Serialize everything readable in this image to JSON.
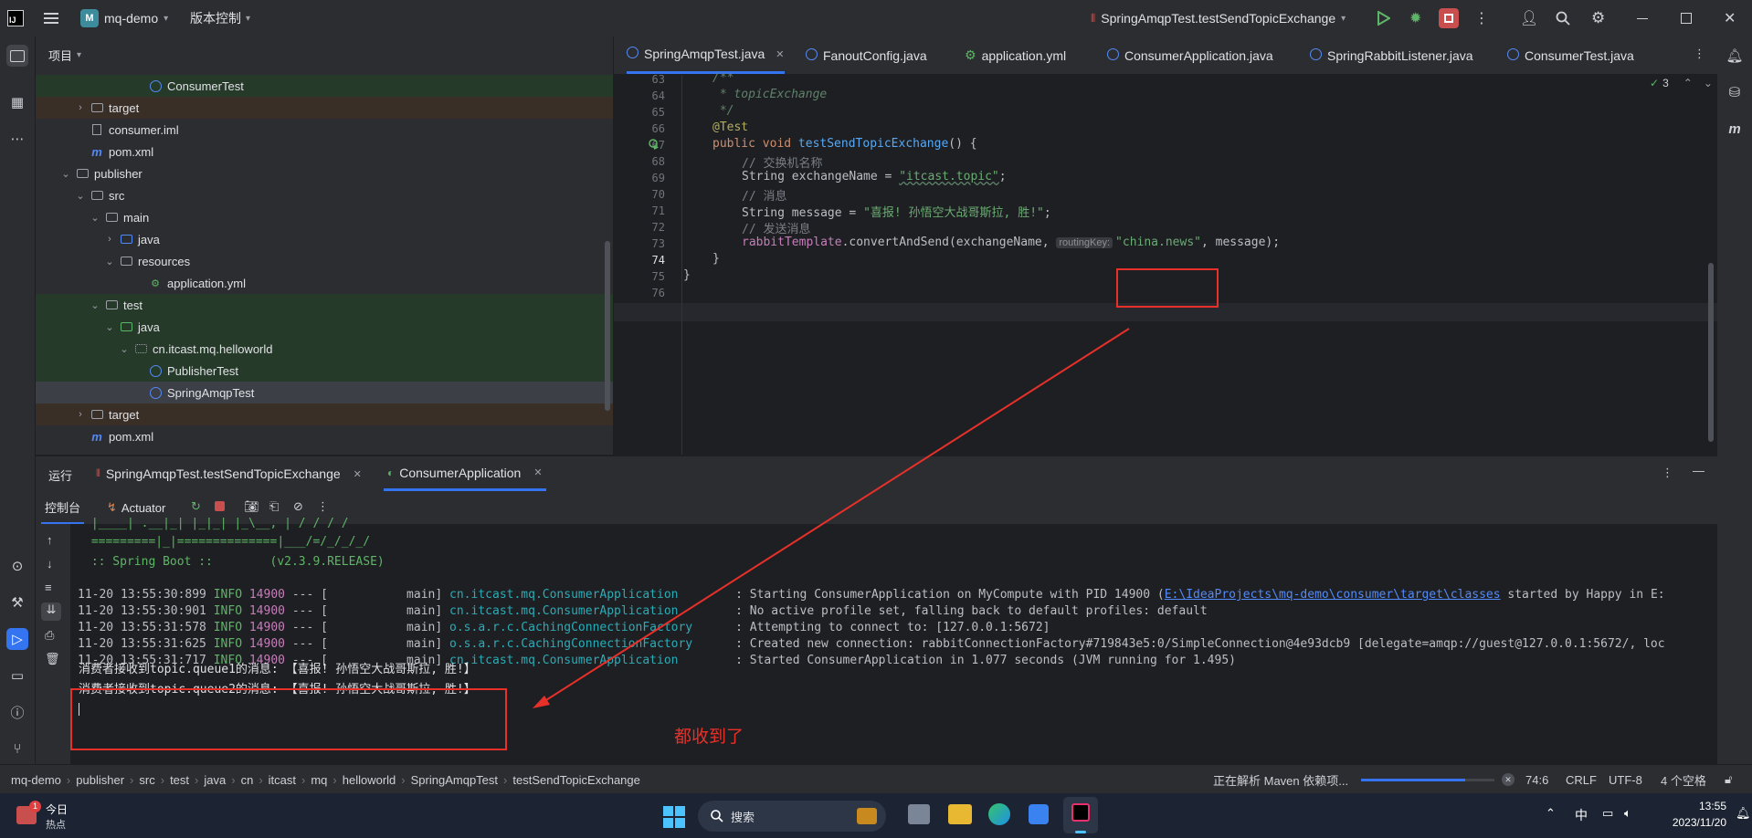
{
  "titlebar": {
    "project_badge": "M",
    "project_name": "mq-demo",
    "vcs_label": "版本控制",
    "run_config": "SpringAmqpTest.testSendTopicExchange"
  },
  "project_panel": {
    "header": "项目",
    "rows": [
      {
        "label": "ConsumerTest",
        "indent": 6,
        "icon": "class",
        "chev": ""
      },
      {
        "label": "target",
        "indent": 2,
        "icon": "folder",
        "chev": "›"
      },
      {
        "label": "consumer.iml",
        "indent": 2,
        "icon": "file",
        "chev": ""
      },
      {
        "label": "pom.xml",
        "indent": 2,
        "icon": "maven",
        "chev": ""
      },
      {
        "label": "publisher",
        "indent": 1,
        "icon": "folder",
        "chev": "⌄"
      },
      {
        "label": "src",
        "indent": 2,
        "icon": "folder",
        "chev": "⌄"
      },
      {
        "label": "main",
        "indent": 3,
        "icon": "folder",
        "chev": "⌄"
      },
      {
        "label": "java",
        "indent": 4,
        "icon": "folder-blue",
        "chev": "›"
      },
      {
        "label": "resources",
        "indent": 4,
        "icon": "folder",
        "chev": "⌄"
      },
      {
        "label": "application.yml",
        "indent": 6,
        "icon": "yml",
        "chev": ""
      },
      {
        "label": "test",
        "indent": 3,
        "icon": "folder",
        "chev": "⌄"
      },
      {
        "label": "java",
        "indent": 4,
        "icon": "folder-green",
        "chev": "⌄"
      },
      {
        "label": "cn.itcast.mq.helloworld",
        "indent": 5,
        "icon": "package",
        "chev": "⌄"
      },
      {
        "label": "PublisherTest",
        "indent": 6,
        "icon": "class",
        "chev": ""
      },
      {
        "label": "SpringAmqpTest",
        "indent": 6,
        "icon": "class",
        "chev": ""
      },
      {
        "label": "target",
        "indent": 2,
        "icon": "folder",
        "chev": "›"
      },
      {
        "label": "pom.xml",
        "indent": 2,
        "icon": "maven",
        "chev": ""
      }
    ]
  },
  "editor_tabs": [
    {
      "label": "SpringAmqpTest.java",
      "active": true
    },
    {
      "label": "FanoutConfig.java",
      "active": false
    },
    {
      "label": "application.yml",
      "active": false
    },
    {
      "label": "ConsumerApplication.java",
      "active": false
    },
    {
      "label": "SpringRabbitListener.java",
      "active": false
    },
    {
      "label": "ConsumerTest.java",
      "active": false
    }
  ],
  "editor": {
    "inspection_count": "3",
    "line_numbers": [
      "63",
      "64",
      "65",
      "66",
      "67",
      "68",
      "69",
      "70",
      "71",
      "72",
      "73",
      "74",
      "75",
      "76"
    ],
    "lines": {
      "l63": "/**",
      "l64": " * topicExchange",
      "l65": " */",
      "l66": "@Test",
      "l67_kw": "public void ",
      "l67_fn": "testSendTopicExchange",
      "l67_rest": "() {",
      "l68": "// 交换机名称",
      "l69_a": "String exchangeName = ",
      "l69_str": "\"itcast.topic\"",
      "l69_b": ";",
      "l70": "// 消息",
      "l71_a": "String message = ",
      "l71_str": "\"喜报! 孙悟空大战哥斯拉, 胜!\"",
      "l71_b": ";",
      "l72": "// 发送消息",
      "l73_field": "rabbitTemplate",
      "l73_a": ".convertAndSend(exchangeName, ",
      "l73_hint": "routingKey:",
      "l73_str": "\"china.news\"",
      "l73_b": ", message);",
      "l74": "}",
      "l75": "}"
    }
  },
  "run_panel": {
    "title": "运行",
    "tab1": "SpringAmqpTest.testSendTopicExchange",
    "tab2": "ConsumerApplication",
    "console_tab": "控制台",
    "actuator_tab": "Actuator"
  },
  "console": {
    "banner1": " |____| .__|_| |_|_| |_\\__, | / / / /",
    "banner2": " =========|_|==============|___/=/_/_/_/",
    "banner3": " :: Spring Boot ::        (v2.3.9.RELEASE)",
    "logs": [
      {
        "ts": "11-20 13:55:30:899",
        "level": "INFO",
        "pid": "14900",
        "sep": "--- [           main]",
        "logger": "cn.itcast.mq.ConsumerApplication        ",
        "msg_a": ": Starting ConsumerApplication on MyCompute with PID 14900 (",
        "link": "E:\\IdeaProjects\\mq-demo\\consumer\\target\\classes",
        "msg_b": " started by Happy in E:"
      },
      {
        "ts": "11-20 13:55:30:901",
        "level": "INFO",
        "pid": "14900",
        "sep": "--- [           main]",
        "logger": "cn.itcast.mq.ConsumerApplication        ",
        "msg_a": ": No active profile set, falling back to default profiles: default",
        "link": "",
        "msg_b": ""
      },
      {
        "ts": "11-20 13:55:31:578",
        "level": "INFO",
        "pid": "14900",
        "sep": "--- [           main]",
        "logger": "o.s.a.r.c.CachingConnectionFactory      ",
        "msg_a": ": Attempting to connect to: [127.0.0.1:5672]",
        "link": "",
        "msg_b": ""
      },
      {
        "ts": "11-20 13:55:31:625",
        "level": "INFO",
        "pid": "14900",
        "sep": "--- [           main]",
        "logger": "o.s.a.r.c.CachingConnectionFactory      ",
        "msg_a": ": Created new connection: rabbitConnectionFactory#719843e5:0/SimpleConnection@4e93dcb9 [delegate=amqp://guest@127.0.0.1:5672/, loc",
        "link": "",
        "msg_b": ""
      },
      {
        "ts": "11-20 13:55:31:717",
        "level": "INFO",
        "pid": "14900",
        "sep": "--- [           main]",
        "logger": "cn.itcast.mq.ConsumerApplication        ",
        "msg_a": ": Started ConsumerApplication in 1.077 seconds (JVM running for 1.495)",
        "link": "",
        "msg_b": ""
      }
    ],
    "received1": "消费者接收到topic.queue1的消息: 【喜报! 孙悟空大战哥斯拉, 胜!】",
    "received2": "消费者接收到topic.queue2的消息: 【喜报! 孙悟空大战哥斯拉, 胜!】",
    "annotation": "都收到了"
  },
  "breadcrumb": [
    "mq-demo",
    "publisher",
    "src",
    "test",
    "java",
    "cn",
    "itcast",
    "mq",
    "helloworld",
    "SpringAmqpTest",
    "testSendTopicExchange"
  ],
  "status": {
    "maven": "正在解析 Maven 依赖项...",
    "maven_progress": 0.78,
    "position": "74:6",
    "line_sep": "CRLF",
    "encoding": "UTF-8",
    "indent": "4 个空格"
  },
  "taskbar": {
    "widget_title": "今日",
    "widget_sub": "热点",
    "widget_badge": "1",
    "search_placeholder": "搜索",
    "ime": "中",
    "time": "13:55",
    "date": "2023/11/20"
  },
  "colors": {
    "accent": "#3574f0",
    "annotation": "#e8302a",
    "bg": "#1e1f22",
    "panel": "#2b2d30"
  }
}
